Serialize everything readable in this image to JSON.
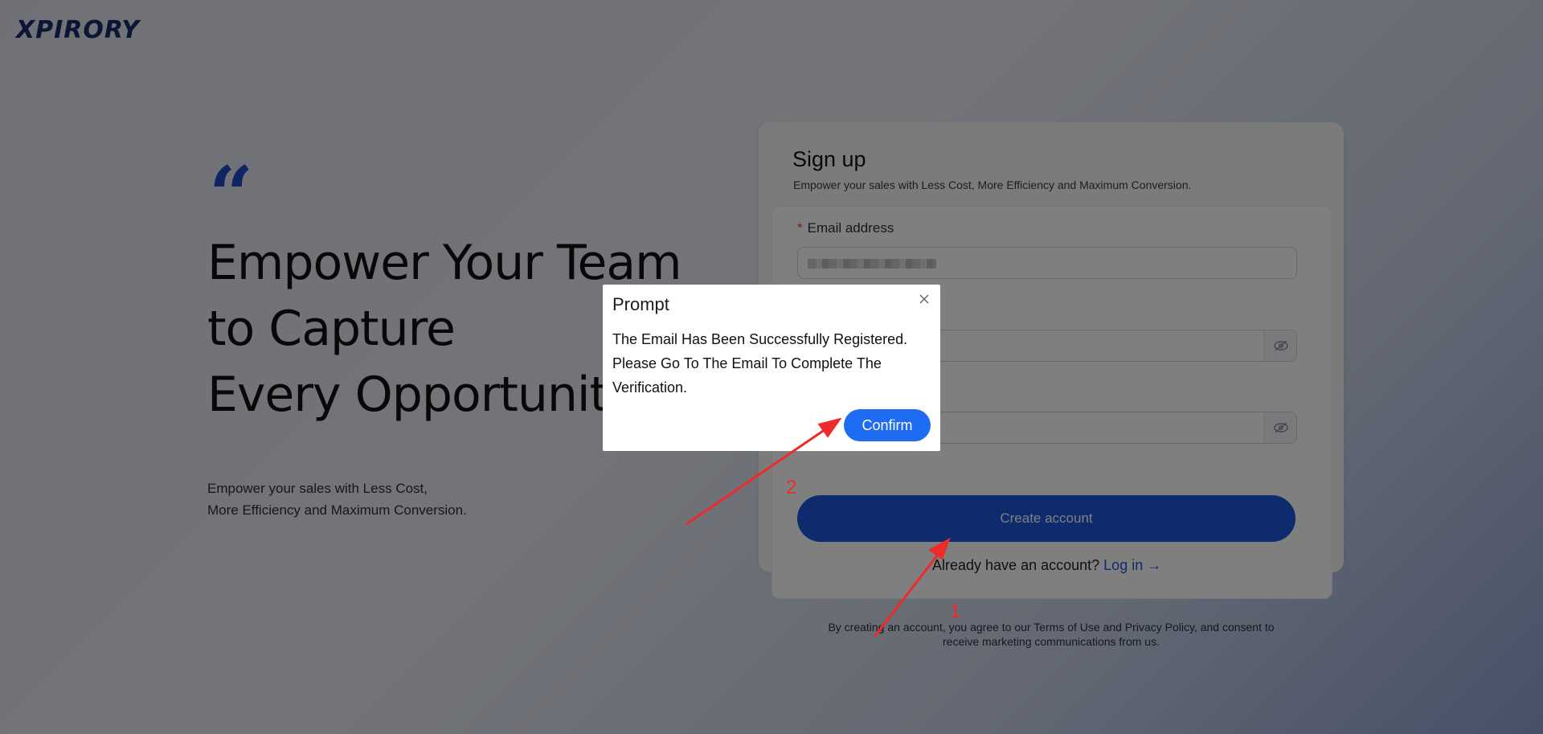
{
  "logo": {
    "text": "XPIRORY"
  },
  "hero": {
    "quote": "“",
    "headline_lines": [
      "Empower Your Team",
      "to Capture",
      "Every Opportunity"
    ],
    "sub_lines": [
      "Empower your sales with Less Cost,",
      "More Efficiency and Maximum Conversion."
    ]
  },
  "signup": {
    "title": "Sign up",
    "subtitle": "Empower your sales with Less Cost, More Efficiency and Maximum Conversion.",
    "email_label": "Email address",
    "required_mark": "*",
    "create_button": "Create account",
    "already_text": "Already have an account?",
    "login_link": "Log in →",
    "terms_lines": [
      "By creating an account, you agree to our Terms of Use and Privacy Policy, and consent to",
      "receive marketing communications from us."
    ]
  },
  "dialog": {
    "title": "Prompt",
    "message_lines": [
      "The Email Has Been Successfully Registered.",
      "Please Go To The Email To Complete The",
      "Verification."
    ],
    "confirm_button": "Confirm"
  },
  "annotations": {
    "step1": "1",
    "step2": "2",
    "color": "#ee2a2a"
  },
  "colors": {
    "primary": "#1a56db",
    "confirm": "#1d6cf2",
    "overlay": "rgba(0,0,0,0.5)"
  }
}
